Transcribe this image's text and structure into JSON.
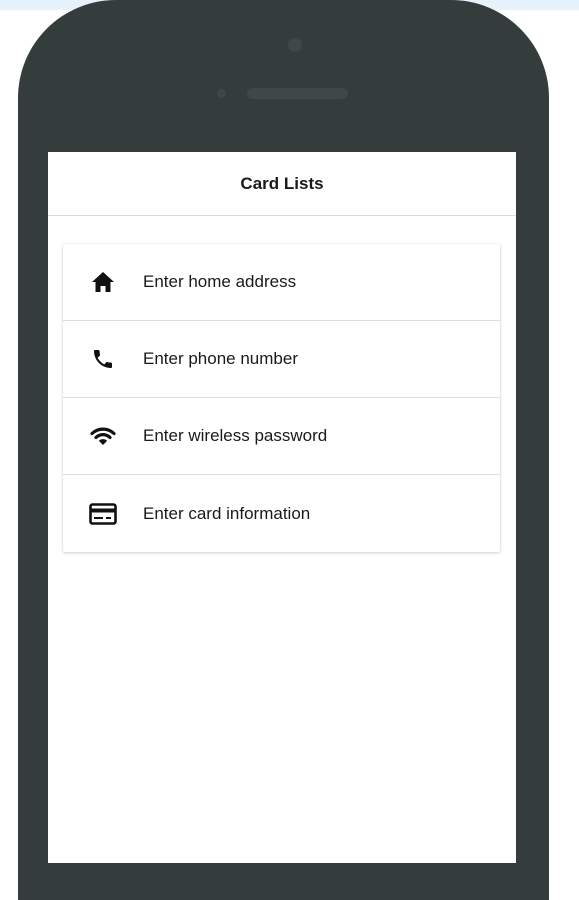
{
  "navbar": {
    "title": "Card Lists"
  },
  "card_list": {
    "items": [
      {
        "label": "Enter home address",
        "icon": "home-icon"
      },
      {
        "label": "Enter phone number",
        "icon": "phone-icon"
      },
      {
        "label": "Enter wireless password",
        "icon": "wifi-icon"
      },
      {
        "label": "Enter card information",
        "icon": "credit-card-icon"
      }
    ]
  },
  "colors": {
    "phone_frame": "#353c3c",
    "screen": "#ffffff",
    "text": "#1a1a1a",
    "divider": "#dedede"
  }
}
